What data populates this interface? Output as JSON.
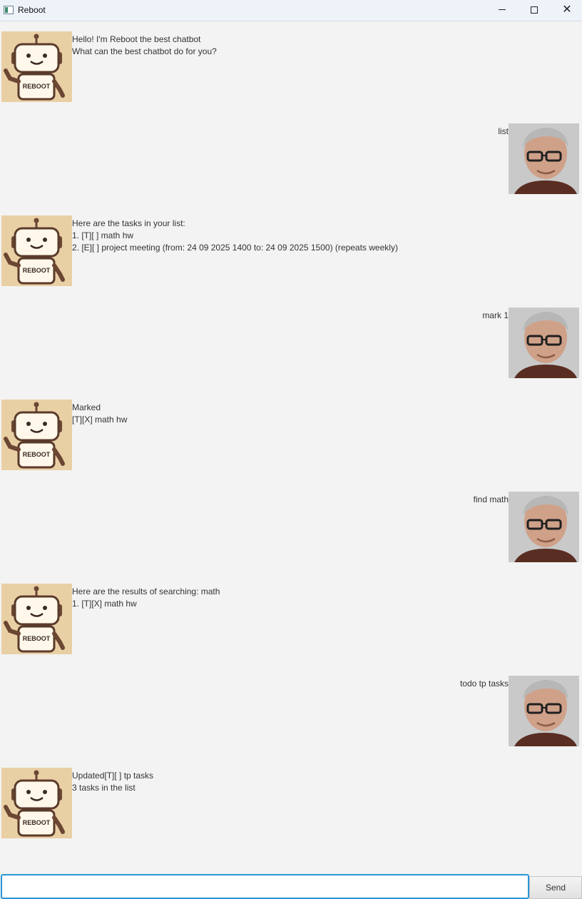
{
  "window": {
    "title": "Reboot",
    "close_glyph": "✕"
  },
  "bot_avatar_label": "REBOOT",
  "input": {
    "value": "",
    "placeholder": ""
  },
  "send_label": "Send",
  "dialogs": [
    {
      "role": "bot",
      "text": "Hello! I'm Reboot the best chatbot\nWhat can the best chatbot do for you?"
    },
    {
      "role": "user",
      "text": "list"
    },
    {
      "role": "bot",
      "text": "Here are the tasks in your list:\n1. [T][ ] math hw\n2. [E][ ] project meeting (from: 24 09 2025 1400 to: 24 09 2025 1500) (repeats weekly)"
    },
    {
      "role": "user",
      "text": "mark 1"
    },
    {
      "role": "bot",
      "text": "Marked\n[T][X] math hw"
    },
    {
      "role": "user",
      "text": "find math"
    },
    {
      "role": "bot",
      "text": "Here are the results of searching: math\n1. [T][X] math hw"
    },
    {
      "role": "user",
      "text": "todo tp tasks"
    },
    {
      "role": "bot",
      "text": "Updated[T][ ] tp tasks\n3 tasks in the list"
    }
  ],
  "colors": {
    "background": "#f3f3f3",
    "titlebar": "#eef2f9",
    "input_focus": "#2a95d6",
    "bot_avatar_bg": "#e9cfa4"
  },
  "icons": {
    "app": "window-app-icon",
    "bot": "robot-avatar-icon",
    "user": "user-photo-avatar"
  }
}
